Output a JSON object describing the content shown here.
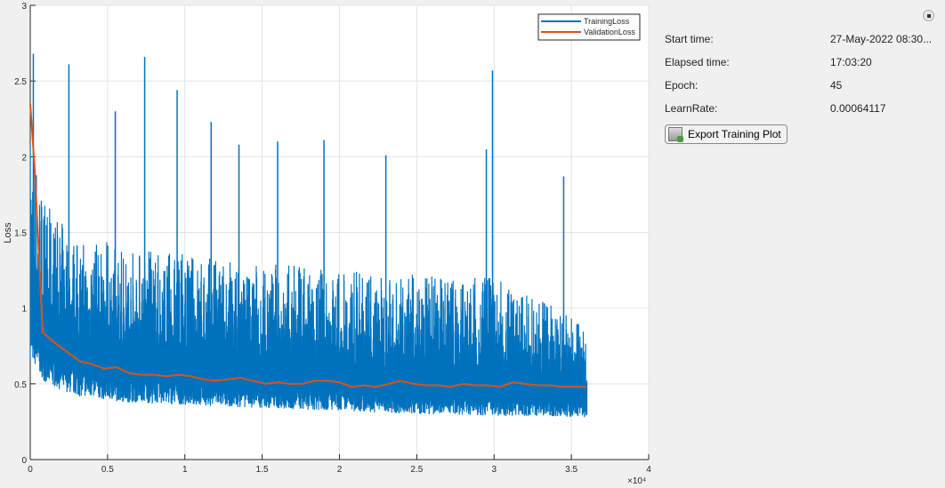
{
  "chart_data": {
    "type": "line",
    "xlabel": "",
    "ylabel": "Loss",
    "x_exponent_label": "×10⁴",
    "xlim": [
      0,
      40000
    ],
    "ylim": [
      0,
      3
    ],
    "xticks": [
      0,
      5000,
      10000,
      15000,
      20000,
      25000,
      30000,
      35000,
      40000
    ],
    "xtick_labels": [
      "0",
      "0.5",
      "1",
      "1.5",
      "2",
      "2.5",
      "3",
      "3.5",
      "4"
    ],
    "yticks": [
      0,
      0.5,
      1,
      1.5,
      2,
      2.5,
      3
    ],
    "ytick_labels": [
      "0",
      "0.5",
      "1",
      "1.5",
      "2",
      "2.5",
      "3"
    ],
    "grid": true,
    "legend_placement": "top-right",
    "colors": {
      "training": "#0072bd",
      "validation": "#d95319"
    },
    "series": [
      {
        "name": "TrainingLoss",
        "band_x": [
          0,
          1000,
          3000,
          6000,
          10000,
          15000,
          20000,
          25000,
          30000,
          36000
        ],
        "band_low": [
          0.67,
          0.5,
          0.42,
          0.38,
          0.36,
          0.34,
          0.32,
          0.3,
          0.29,
          0.28
        ],
        "band_high": [
          2.0,
          1.5,
          1.3,
          1.25,
          1.2,
          1.15,
          1.1,
          1.07,
          1.05,
          0.8
        ],
        "spikes": [
          [
            200,
            2.68
          ],
          [
            2500,
            2.61
          ],
          [
            5500,
            2.3
          ],
          [
            7400,
            2.66
          ],
          [
            9500,
            2.44
          ],
          [
            11700,
            2.23
          ],
          [
            13500,
            2.08
          ],
          [
            16000,
            2.1
          ],
          [
            19000,
            2.11
          ],
          [
            23000,
            2.01
          ],
          [
            29500,
            2.05
          ],
          [
            29900,
            2.57
          ],
          [
            34500,
            1.87
          ]
        ]
      },
      {
        "name": "ValidationLoss",
        "x": [
          0,
          300,
          800,
          1600,
          2400,
          3200,
          4000,
          4800,
          5600,
          6400,
          7200,
          8000,
          8800,
          9600,
          10400,
          11200,
          12000,
          12800,
          13600,
          14400,
          15200,
          16000,
          16800,
          17600,
          18400,
          19200,
          20000,
          20800,
          21600,
          22400,
          23200,
          24000,
          24800,
          25600,
          26400,
          27200,
          28000,
          28800,
          29600,
          30400,
          31200,
          32000,
          32800,
          33600,
          34400,
          35200,
          36000
        ],
        "y": [
          2.35,
          1.9,
          0.84,
          0.77,
          0.71,
          0.65,
          0.63,
          0.6,
          0.61,
          0.57,
          0.56,
          0.56,
          0.55,
          0.56,
          0.55,
          0.53,
          0.52,
          0.53,
          0.54,
          0.52,
          0.5,
          0.51,
          0.5,
          0.5,
          0.52,
          0.52,
          0.51,
          0.48,
          0.49,
          0.48,
          0.5,
          0.52,
          0.5,
          0.49,
          0.49,
          0.48,
          0.5,
          0.49,
          0.49,
          0.48,
          0.51,
          0.5,
          0.49,
          0.49,
          0.48,
          0.48,
          0.48
        ]
      }
    ]
  },
  "info": {
    "start_label": "Start time:",
    "start_value": "27-May-2022 08:30...",
    "elapsed_label": "Elapsed time:",
    "elapsed_value": "17:03:20",
    "epoch_label": "Epoch:",
    "epoch_value": "45",
    "lr_label": "LearnRate:",
    "lr_value": "0.00064117",
    "export_label": "Export Training Plot",
    "stop_icon": "stop-icon"
  }
}
